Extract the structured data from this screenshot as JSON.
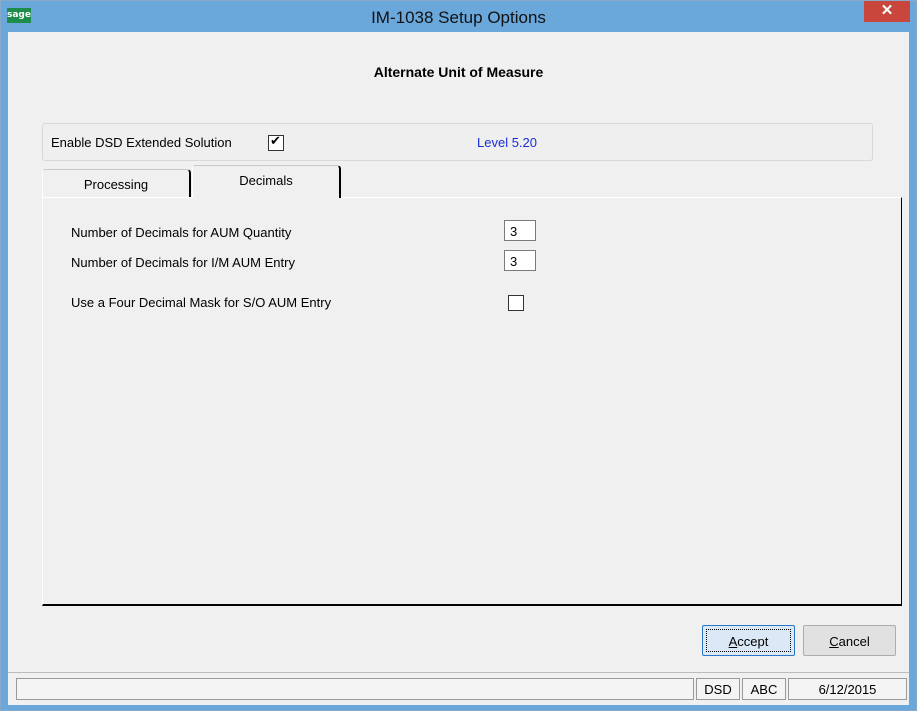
{
  "window": {
    "title": "IM-1038 Setup Options",
    "logo_text": "sage",
    "close_glyph": "✕"
  },
  "header": {
    "title": "Alternate Unit of Measure"
  },
  "extended": {
    "enable_label": "Enable DSD Extended Solution",
    "enable_checked": true,
    "level": "Level  5.20"
  },
  "tabs": [
    {
      "label": "Processing",
      "selected": false
    },
    {
      "label": "Decimals",
      "selected": true
    }
  ],
  "decimals": {
    "aum_quantity": {
      "label": "Number of Decimals for AUM Quantity",
      "value": "3"
    },
    "im_aum_entry": {
      "label": "Number of Decimals for I/M AUM Entry",
      "value": "3"
    },
    "four_decimal_mask": {
      "label": "Use a Four Decimal Mask for S/O AUM Entry",
      "checked": false
    }
  },
  "buttons": {
    "accept": {
      "mnemonic": "A",
      "rest": "ccept"
    },
    "cancel": {
      "mnemonic": "C",
      "rest": "ancel"
    }
  },
  "statusbar": {
    "company_code": "DSD",
    "user": "ABC",
    "date": "6/12/2015"
  },
  "colors": {
    "titlebar": "#6aa8dc",
    "close": "#c9463d",
    "level_text": "#1a2ed6"
  }
}
